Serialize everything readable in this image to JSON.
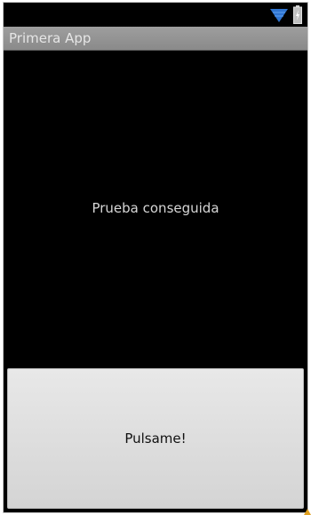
{
  "status_bar": {
    "icons": [
      "wifi-icon",
      "battery-icon"
    ],
    "accent_color": "#2f74d0"
  },
  "title_bar": {
    "title": "Primera App"
  },
  "main": {
    "message": "Prueba conseguida"
  },
  "button": {
    "label": "Pulsame!"
  },
  "colors": {
    "background": "#000000",
    "title_bar": "#939393",
    "button": "#dcdcdc"
  }
}
